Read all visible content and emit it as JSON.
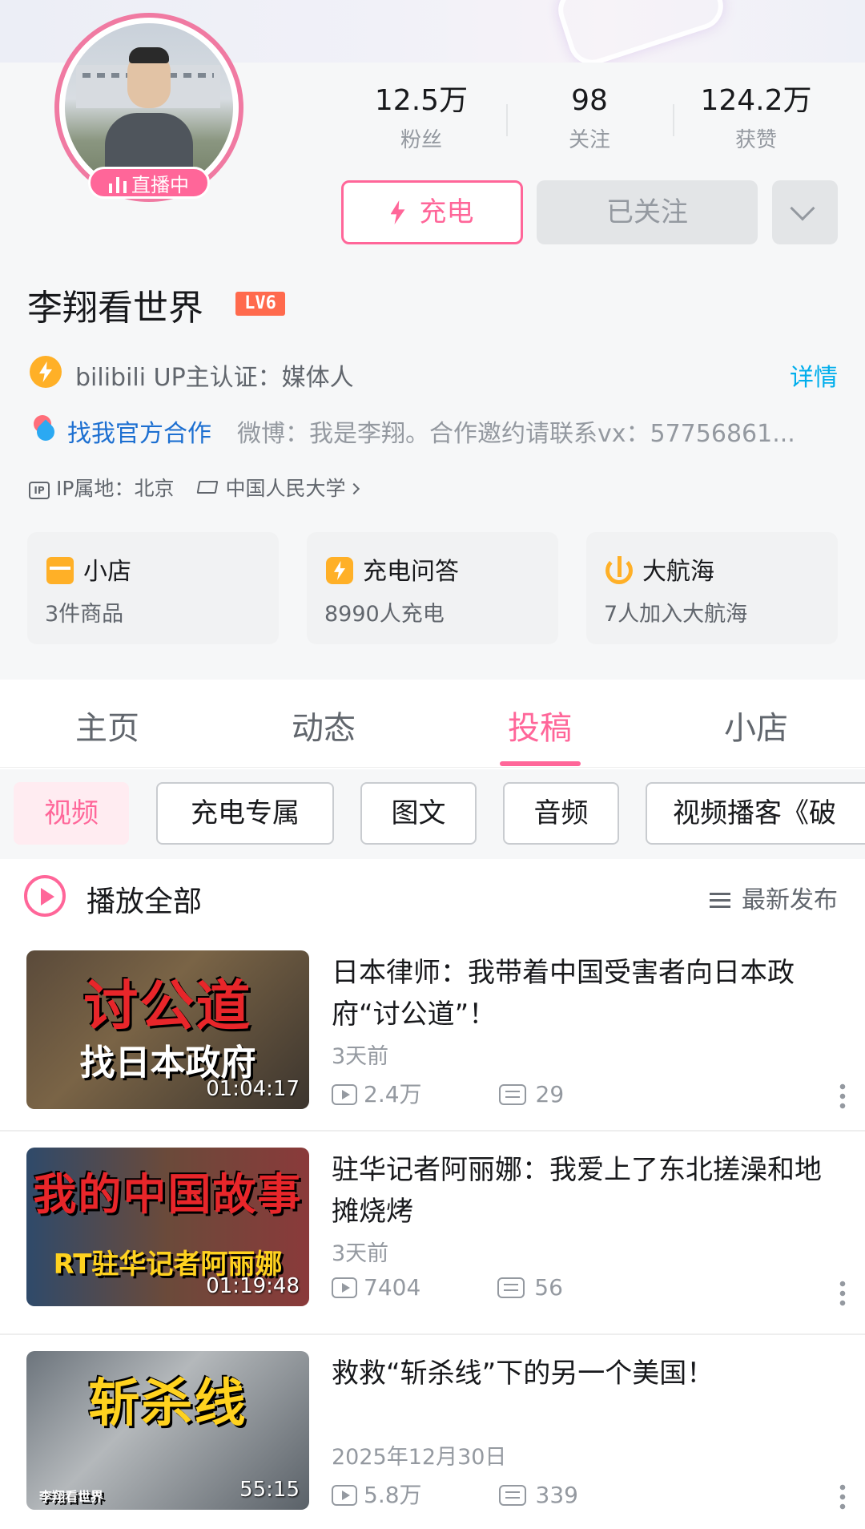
{
  "profile": {
    "name": "李翔看世界",
    "level": "LV6",
    "live_badge": "直播中",
    "stats": [
      {
        "value": "12.5万",
        "label": "粉丝"
      },
      {
        "value": "98",
        "label": "关注"
      },
      {
        "value": "124.2万",
        "label": "获赞"
      }
    ],
    "buttons": {
      "charge": "充电",
      "followed": "已关注"
    },
    "certification": "bilibili UP主认证：媒体人",
    "detail_link": "详情",
    "cooperation_link": "找我官方合作",
    "bio": "微博：我是李翔。合作邀约请联系vx：57756861...",
    "ip_label": "IP属地：北京",
    "school": "中国人民大学",
    "cards": [
      {
        "title": "小店",
        "subtitle": "3件商品"
      },
      {
        "title": "充电问答",
        "subtitle": "8990人充电"
      },
      {
        "title": "大航海",
        "subtitle": "7人加入大航海"
      }
    ]
  },
  "tabs": [
    {
      "label": "主页",
      "active": false
    },
    {
      "label": "动态",
      "active": false
    },
    {
      "label": "投稿",
      "active": true
    },
    {
      "label": "小店",
      "active": false
    }
  ],
  "filter_chips": [
    "视频",
    "充电专属",
    "图文",
    "音频",
    "视频播客《破"
  ],
  "list_header": {
    "play_all": "播放全部",
    "sort": "最新发布"
  },
  "videos": [
    {
      "title": "日本律师：我带着中国受害者向日本政府“讨公道”！",
      "date": "3天前",
      "views": "2.4万",
      "danmaku": "29",
      "duration": "01:04:17",
      "thumb_text": "讨公道",
      "thumb_sub": "找日本政府"
    },
    {
      "title": "驻华记者阿丽娜：我爱上了东北搓澡和地摊烧烤",
      "date": "3天前",
      "views": "7404",
      "danmaku": "56",
      "duration": "01:19:48",
      "thumb_text": "我的中国故事",
      "thumb_sub": "RT驻华记者阿丽娜"
    },
    {
      "title": "救救“斩杀线”下的另一个美国！",
      "date": "2025年12月30日",
      "views": "5.8万",
      "danmaku": "339",
      "duration": "55:15",
      "thumb_text": "斩杀线",
      "thumb_sub": "李翔看世界"
    }
  ],
  "colors": {
    "accent": "#ff6699",
    "link": "#00aeec",
    "level": "#ff6a4d",
    "gold": "#ffb027"
  }
}
